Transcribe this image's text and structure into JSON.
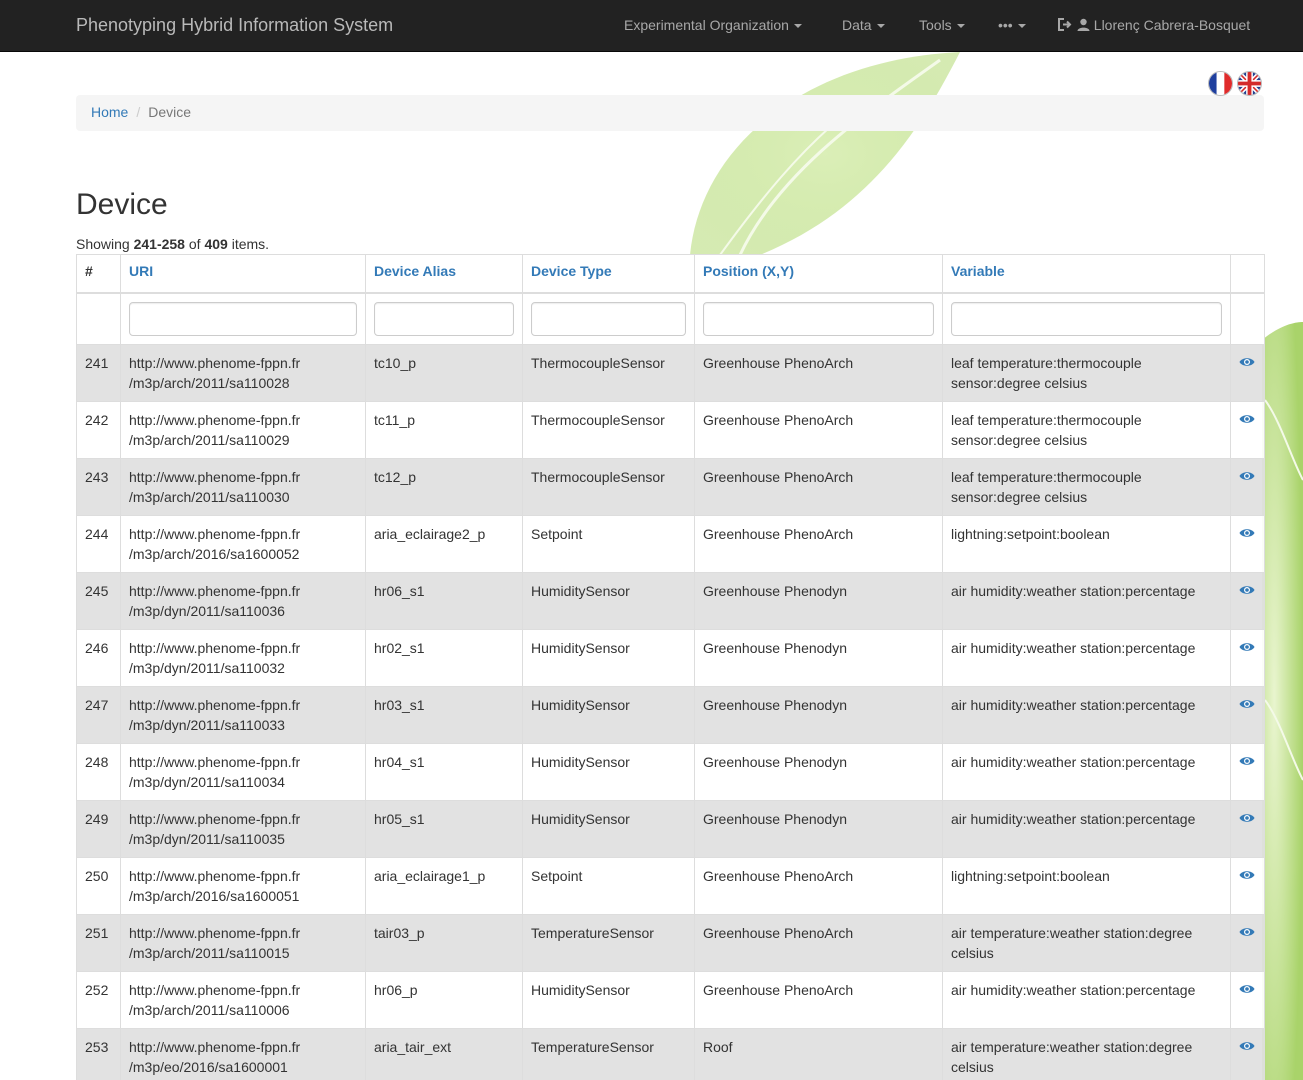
{
  "navbar": {
    "brand": "Phenotyping Hybrid Information System",
    "items": [
      {
        "label": "Experimental Organization"
      },
      {
        "label": "Data"
      },
      {
        "label": "Tools"
      },
      {
        "label": "•••"
      }
    ],
    "user": "Llorenç Cabrera-Bosquet"
  },
  "breadcrumb": {
    "home": "Home",
    "current": "Device"
  },
  "page": {
    "title": "Device",
    "summary_prefix": "Showing ",
    "range": "241-258",
    "summary_of": " of ",
    "total": "409",
    "summary_suffix": " items."
  },
  "table": {
    "columns": [
      "#",
      "URI",
      "Device Alias",
      "Device Type",
      "Position (X,Y)",
      "Variable"
    ],
    "rows": [
      {
        "num": "241",
        "uri1": "http://www.phenome-fppn.fr",
        "uri2": "/m3p/arch/2011/sa110028",
        "alias": "tc10_p",
        "type": "ThermocoupleSensor",
        "position": "Greenhouse PhenoArch",
        "variable": "leaf temperature:thermocouple sensor:degree celsius"
      },
      {
        "num": "242",
        "uri1": "http://www.phenome-fppn.fr",
        "uri2": "/m3p/arch/2011/sa110029",
        "alias": "tc11_p",
        "type": "ThermocoupleSensor",
        "position": "Greenhouse PhenoArch",
        "variable": "leaf temperature:thermocouple sensor:degree celsius"
      },
      {
        "num": "243",
        "uri1": "http://www.phenome-fppn.fr",
        "uri2": "/m3p/arch/2011/sa110030",
        "alias": "tc12_p",
        "type": "ThermocoupleSensor",
        "position": "Greenhouse PhenoArch",
        "variable": "leaf temperature:thermocouple sensor:degree celsius"
      },
      {
        "num": "244",
        "uri1": "http://www.phenome-fppn.fr",
        "uri2": "/m3p/arch/2016/sa1600052",
        "alias": "aria_eclairage2_p",
        "type": "Setpoint",
        "position": "Greenhouse PhenoArch",
        "variable": "lightning:setpoint:boolean"
      },
      {
        "num": "245",
        "uri1": "http://www.phenome-fppn.fr",
        "uri2": "/m3p/dyn/2011/sa110036",
        "alias": "hr06_s1",
        "type": "HumiditySensor",
        "position": "Greenhouse Phenodyn",
        "variable": "air humidity:weather station:percentage"
      },
      {
        "num": "246",
        "uri1": "http://www.phenome-fppn.fr",
        "uri2": "/m3p/dyn/2011/sa110032",
        "alias": "hr02_s1",
        "type": "HumiditySensor",
        "position": "Greenhouse Phenodyn",
        "variable": "air humidity:weather station:percentage"
      },
      {
        "num": "247",
        "uri1": "http://www.phenome-fppn.fr",
        "uri2": "/m3p/dyn/2011/sa110033",
        "alias": "hr03_s1",
        "type": "HumiditySensor",
        "position": "Greenhouse Phenodyn",
        "variable": "air humidity:weather station:percentage"
      },
      {
        "num": "248",
        "uri1": "http://www.phenome-fppn.fr",
        "uri2": "/m3p/dyn/2011/sa110034",
        "alias": "hr04_s1",
        "type": "HumiditySensor",
        "position": "Greenhouse Phenodyn",
        "variable": "air humidity:weather station:percentage"
      },
      {
        "num": "249",
        "uri1": "http://www.phenome-fppn.fr",
        "uri2": "/m3p/dyn/2011/sa110035",
        "alias": "hr05_s1",
        "type": "HumiditySensor",
        "position": "Greenhouse Phenodyn",
        "variable": "air humidity:weather station:percentage"
      },
      {
        "num": "250",
        "uri1": "http://www.phenome-fppn.fr",
        "uri2": "/m3p/arch/2016/sa1600051",
        "alias": "aria_eclairage1_p",
        "type": "Setpoint",
        "position": "Greenhouse PhenoArch",
        "variable": "lightning:setpoint:boolean"
      },
      {
        "num": "251",
        "uri1": "http://www.phenome-fppn.fr",
        "uri2": "/m3p/arch/2011/sa110015",
        "alias": "tair03_p",
        "type": "TemperatureSensor",
        "position": "Greenhouse PhenoArch",
        "variable": "air temperature:weather station:degree celsius"
      },
      {
        "num": "252",
        "uri1": "http://www.phenome-fppn.fr",
        "uri2": "/m3p/arch/2011/sa110006",
        "alias": "hr06_p",
        "type": "HumiditySensor",
        "position": "Greenhouse PhenoArch",
        "variable": "air humidity:weather station:percentage"
      },
      {
        "num": "253",
        "uri1": "http://www.phenome-fppn.fr",
        "uri2": "/m3p/eo/2016/sa1600001",
        "alias": "aria_tair_ext",
        "type": "TemperatureSensor",
        "position": "Roof",
        "variable": "air temperature:weather station:degree celsius"
      }
    ]
  },
  "colors": {
    "navbar": "#222222",
    "link": "#337ab7",
    "stripe": "#e0e0e0"
  },
  "icons": {
    "view": "eye-icon",
    "user": "user-icon",
    "logout": "sign-out-icon",
    "flag_fr": "flag-fr-icon",
    "flag_en": "flag-uk-icon"
  }
}
